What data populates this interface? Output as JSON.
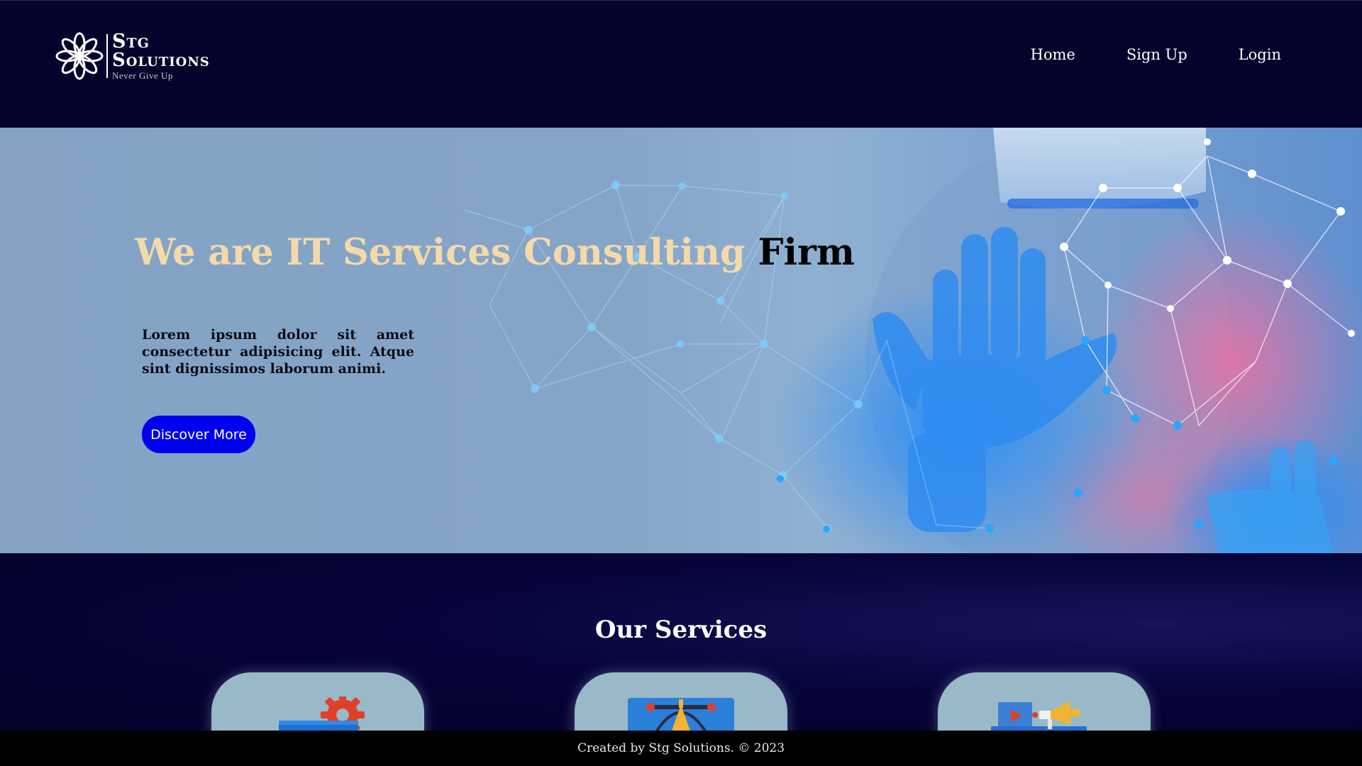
{
  "brand": {
    "name_line1": "Stg",
    "name_line2": "Solutions",
    "tagline": "Never Give Up"
  },
  "nav": {
    "home": "Home",
    "signup": "Sign Up",
    "login": "Login"
  },
  "hero": {
    "heading_light": "We are IT Services Consulting",
    "heading_dark": "Firm",
    "body": "Lorem ipsum dolor sit amet consectetur adipisicing elit. Atque sint dignissimos laborum animi.",
    "button": "Discover More"
  },
  "services": {
    "title": "Our Services",
    "cards": [
      {
        "icon": "settings-folder-icon"
      },
      {
        "icon": "design-pen-tool-icon"
      },
      {
        "icon": "marketing-megaphone-icon"
      }
    ]
  },
  "footer": {
    "text": "Created by Stg Solutions. © 2023"
  },
  "colors": {
    "header_bg": "#05022b",
    "hero_heading": "#f4d9a9",
    "button_bg": "#0000ee",
    "card_bg": "#99b9c9",
    "footer_bg": "#000000"
  }
}
